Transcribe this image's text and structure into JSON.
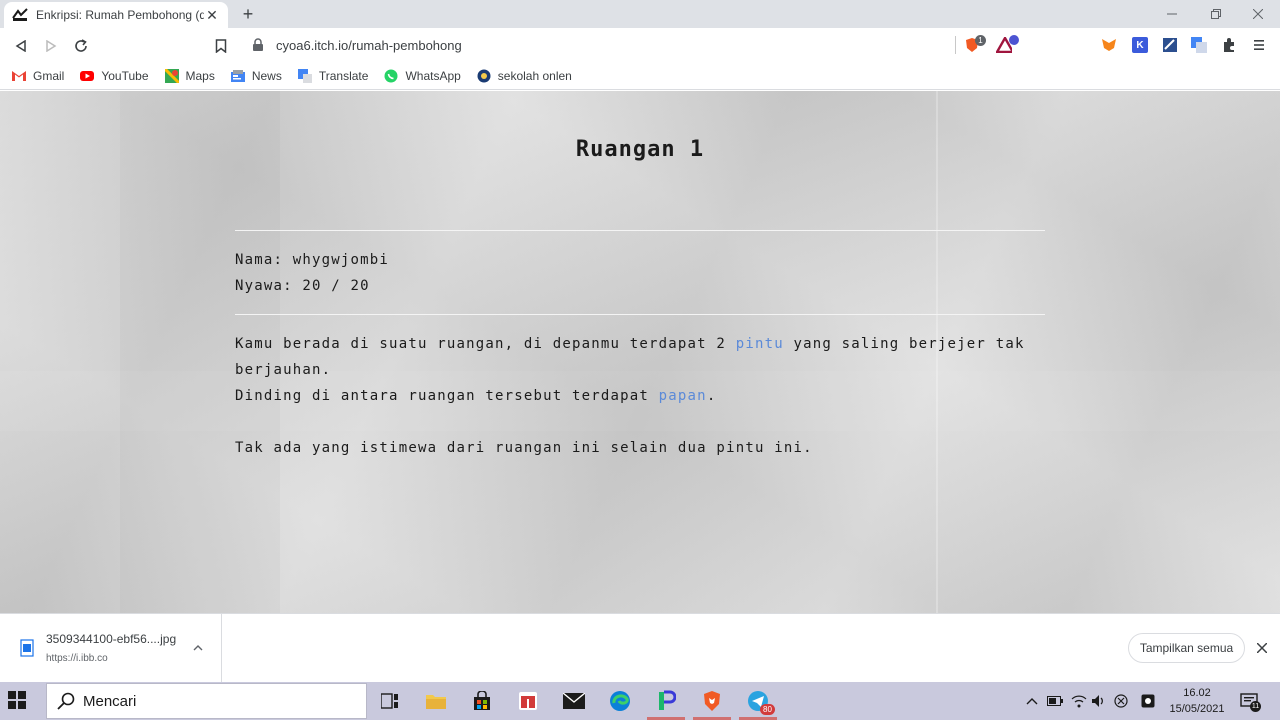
{
  "browser": {
    "tab": {
      "title": "Enkripsi: Rumah Pembohong (den",
      "close": "✕"
    },
    "new_tab": "+",
    "address": "cyoa6.itch.io/rumah-pembohong",
    "extension_badges": {
      "brave": "1"
    },
    "bookmarks": [
      {
        "label": "Gmail",
        "icon": "gmail-icon",
        "color": "#ea4335"
      },
      {
        "label": "YouTube",
        "icon": "youtube-icon",
        "color": "#ff0000"
      },
      {
        "label": "Maps",
        "icon": "maps-icon",
        "color": "#34a853"
      },
      {
        "label": "News",
        "icon": "news-icon",
        "color": "#4285f4"
      },
      {
        "label": "Translate",
        "icon": "translate-icon",
        "color": "#4285f4"
      },
      {
        "label": "WhatsApp",
        "icon": "whatsapp-icon",
        "color": "#25d366"
      },
      {
        "label": "sekolah onlen",
        "icon": "sekolah-icon",
        "color": "#1a3b73"
      }
    ]
  },
  "game": {
    "title": "Ruangan 1",
    "name_line": "Nama: whygwjombi",
    "health_line": "Nyawa: 20 / 20",
    "para1_pre": "Kamu berada di suatu ruangan, di depanmu terdapat 2 ",
    "para1_link": "pintu",
    "para1_post": " yang saling berjejer tak berjauhan.",
    "para2_pre": "Dinding di antara ruangan tersebut terdapat ",
    "para2_link": "papan",
    "para2_post": ".",
    "para3": "Tak ada yang istimewa dari ruangan ini selain dua pintu ini.",
    "link_color": "#5b8ad8"
  },
  "download": {
    "filename": "3509344100-ebf56....jpg",
    "source": "https://i.ibb.co",
    "show_all": "Tampilkan semua"
  },
  "taskbar": {
    "search_placeholder": "Mencari",
    "time": "16.02",
    "date": "15/05/2021",
    "telegram_badge": "80",
    "notification_count": "11"
  }
}
